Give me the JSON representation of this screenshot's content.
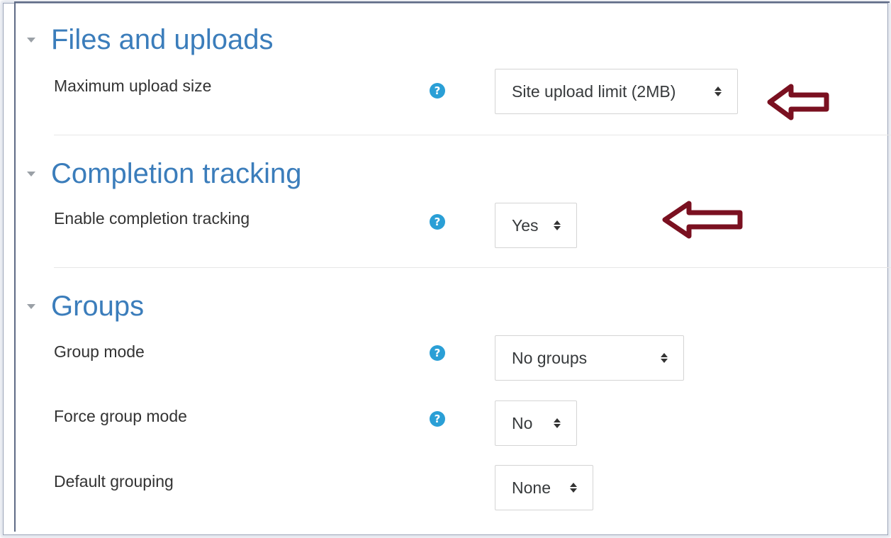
{
  "sections": [
    {
      "title": "Files and uploads",
      "fields": [
        {
          "label": "Maximum upload size",
          "value": "Site upload limit (2MB)",
          "has_help": true
        }
      ]
    },
    {
      "title": "Completion tracking",
      "fields": [
        {
          "label": "Enable completion tracking",
          "value": "Yes",
          "has_help": true
        }
      ]
    },
    {
      "title": "Groups",
      "fields": [
        {
          "label": "Group mode",
          "value": "No groups",
          "has_help": true
        },
        {
          "label": "Force group mode",
          "value": "No",
          "has_help": true
        },
        {
          "label": "Default grouping",
          "value": "None",
          "has_help": false
        }
      ]
    }
  ],
  "help_icon_glyph": "?",
  "colors": {
    "heading": "#3b7dbb",
    "help_icon": "#2a9fd6",
    "annotation_arrow": "#7a1020"
  },
  "icons": {
    "section_toggle": "caret-down-icon",
    "help": "question-circle-icon",
    "select": "sort-icon",
    "annotation": "left-arrow-icon"
  }
}
